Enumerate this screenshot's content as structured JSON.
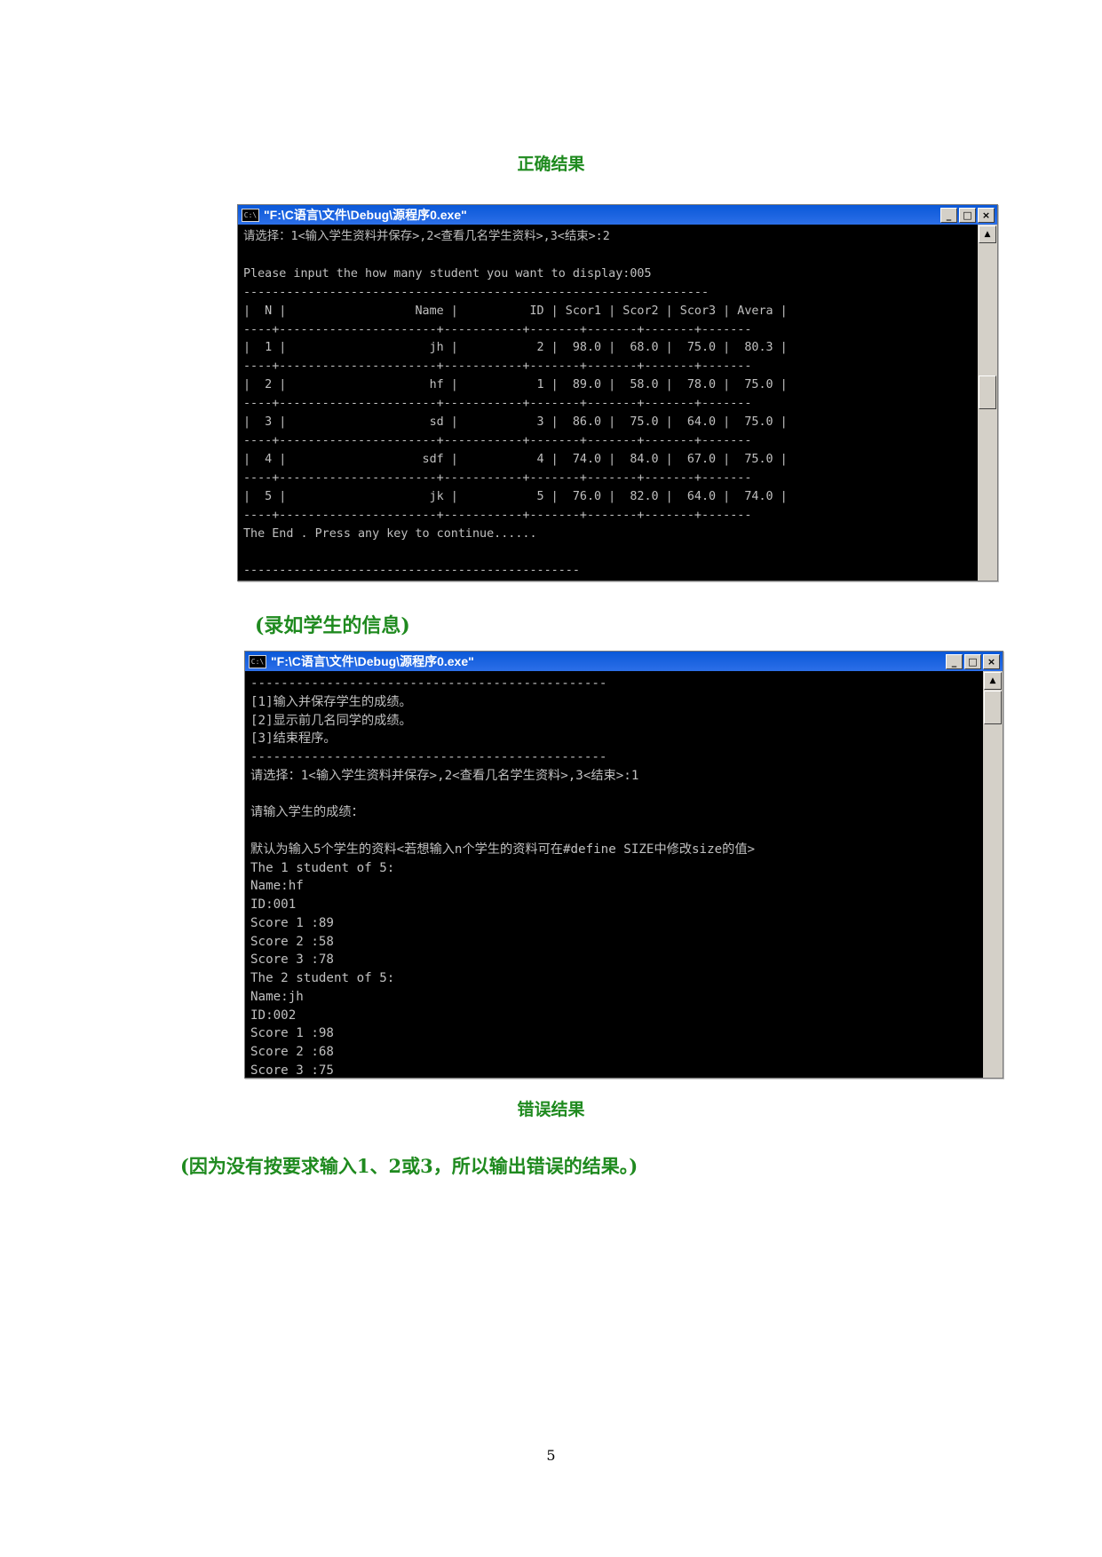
{
  "captions": {
    "correct_result": "正确结果",
    "input_info": "(录如学生的信息)",
    "wrong_result": "错误结果",
    "explanation": "(因为没有按要求输入1、2或3，所以输出错误的结果。)"
  },
  "window1": {
    "title": "\"F:\\C语言\\文件\\Debug\\源程序0.exe\"",
    "console_text": "请选择：1<输入学生资料并保存>,2<查看几名学生资料>,3<结束>:2\n\nPlease input the how many student you want to display:005\n-----------------------------------------------------------------\n|  N |                  Name |          ID | Scor1 | Scor2 | Scor3 | Avera |\n----+----------------------+-----------+-------+-------+-------+-------\n|  1 |                    jh |           2 |  98.0 |  68.0 |  75.0 |  80.3 |\n----+----------------------+-----------+-------+-------+-------+-------\n|  2 |                    hf |           1 |  89.0 |  58.0 |  78.0 |  75.0 |\n----+----------------------+-----------+-------+-------+-------+-------\n|  3 |                    sd |           3 |  86.0 |  75.0 |  64.0 |  75.0 |\n----+----------------------+-----------+-------+-------+-------+-------\n|  4 |                   sdf |           4 |  74.0 |  84.0 |  67.0 |  75.0 |\n----+----------------------+-----------+-------+-------+-------+-------\n|  5 |                    jk |           5 |  76.0 |  82.0 |  64.0 |  74.0 |\n----+----------------------+-----------+-------+-------+-------+-------\nThe End . Press any key to continue......\n\n-----------------------------------------------"
  },
  "window2": {
    "title": "\"F:\\C语言\\文件\\Debug\\源程序0.exe\"",
    "console_text": "-----------------------------------------------\n[1]输入并保存学生的成绩。\n[2]显示前几名同学的成绩。\n[3]结束程序。\n-----------------------------------------------\n请选择：1<输入学生资料并保存>,2<查看几名学生资料>,3<结束>:1\n\n请输入学生的成绩：\n\n默认为输入5个学生的资料<若想输入n个学生的资料可在#define SIZE中修改size的值>\nThe 1 student of 5:\nName:hf\nID:001\nScore 1 :89\nScore 2 :58\nScore 3 :78\nThe 2 student of 5:\nName:jh\nID:002\nScore 1 :98\nScore 2 :68\nScore 3 :75"
  },
  "window_buttons": {
    "minimize": "_",
    "maximize": "□",
    "close": "×"
  },
  "page_number": "5"
}
